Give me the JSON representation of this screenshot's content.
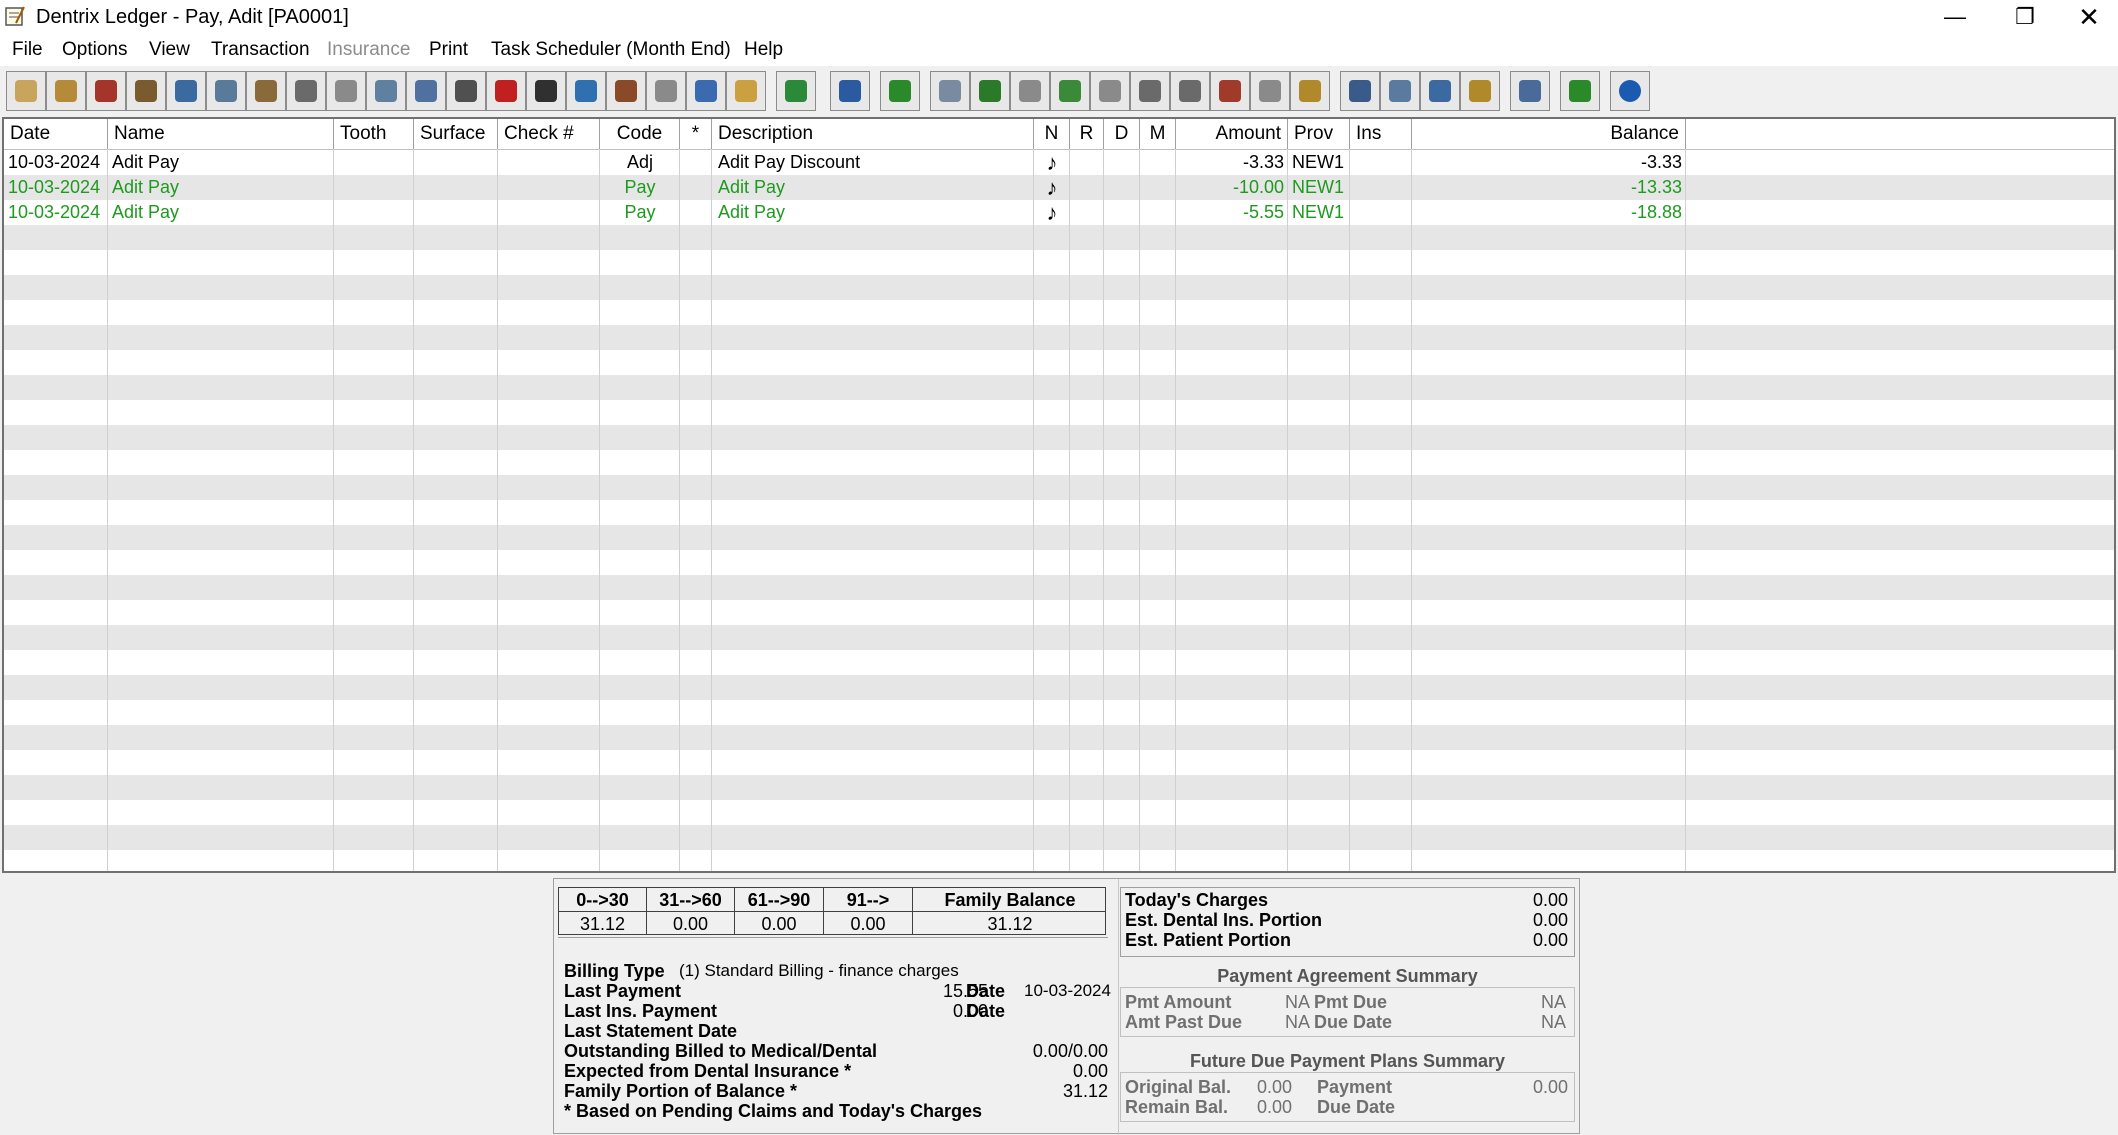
{
  "window": {
    "title": "Dentrix Ledger - Pay, Adit [PA0001]"
  },
  "menu": [
    {
      "label": "File",
      "disabled": false
    },
    {
      "label": "Options",
      "disabled": false
    },
    {
      "label": "View",
      "disabled": false
    },
    {
      "label": "Transaction",
      "disabled": false
    },
    {
      "label": "Insurance",
      "disabled": true
    },
    {
      "label": "Print",
      "disabled": false
    },
    {
      "label": "Task Scheduler (Month End)",
      "disabled": false
    },
    {
      "label": "Help",
      "disabled": false
    }
  ],
  "toolbar_icons": [
    "tooth-icon",
    "folder-icon",
    "book-icon",
    "chair-icon",
    "patient-card-icon",
    "map-icon",
    "pen-icon",
    "eraser-icon",
    "note-icon",
    "clock-icon",
    "at-icon",
    "list-icon",
    "medical-cross-icon",
    "rx-icon",
    "credit-card-icon",
    "wallet-icon",
    "lab-icon",
    "box-icon",
    "eob-icon",
    "plant-icon",
    "person-icon",
    "refresh-icon",
    "handshake-icon",
    "dollar-icon",
    "g-icon",
    "transfer-icon",
    "tooth-plan-icon",
    "ins-claim-icon",
    "ins-batch-icon",
    "tx-icon",
    "calculator-icon",
    "save-icon",
    "walk-icon",
    "mail-icon",
    "family-icon",
    "door-icon",
    "doctor-icon",
    "user-add-icon",
    "info-icon"
  ],
  "columns": [
    "Date",
    "Name",
    "Tooth",
    "Surface",
    "Check #",
    "Code",
    "*",
    "Description",
    "N",
    "R",
    "D",
    "M",
    "Amount",
    "Prov",
    "Ins",
    "Balance"
  ],
  "rows": [
    {
      "date": "10-03-2024",
      "name": "Adit  Pay",
      "code": "Adj",
      "description": "Adit Pay Discount",
      "note": "♪",
      "amount": "-3.33",
      "prov": "NEW1",
      "balance": "-3.33",
      "color": "#000000"
    },
    {
      "date": "10-03-2024",
      "name": "Adit  Pay",
      "code": "Pay",
      "description": "Adit Pay",
      "note": "♪",
      "amount": "-10.00",
      "prov": "NEW1",
      "balance": "-13.33",
      "color": "#1e9a1e"
    },
    {
      "date": "10-03-2024",
      "name": "Adit  Pay",
      "code": "Pay",
      "description": "Adit Pay",
      "note": "♪",
      "amount": "-5.55",
      "prov": "NEW1",
      "balance": "-18.88",
      "color": "#1e9a1e"
    }
  ],
  "aging": {
    "headers": [
      "0-->30",
      "31-->60",
      "61-->90",
      "91-->",
      "Family Balance"
    ],
    "values": [
      "31.12",
      "0.00",
      "0.00",
      "0.00",
      "31.12"
    ]
  },
  "billing": {
    "billing_type_label": "Billing Type",
    "billing_type_value": "(1) Standard Billing - finance charges",
    "last_payment_label": "Last Payment",
    "last_payment_value": "15.55",
    "date_label": "Date",
    "last_payment_date": "10-03-2024",
    "last_ins_payment_label": "Last Ins. Payment",
    "last_ins_payment_value": "0.00",
    "last_ins_date_label": "Date",
    "last_statement_label": "Last Statement Date",
    "outstanding_label": "Outstanding Billed to Medical/Dental",
    "outstanding_value": "0.00/0.00",
    "expected_label": "Expected from Dental Insurance *",
    "expected_value": "0.00",
    "family_portion_label": "Family Portion of Balance *",
    "family_portion_value": "31.12",
    "footnote": "* Based on Pending Claims and Today's Charges"
  },
  "today": {
    "charges_label": "Today's Charges",
    "charges_value": "0.00",
    "ins_label": "Est. Dental Ins. Portion",
    "ins_value": "0.00",
    "patient_label": "Est. Patient Portion",
    "patient_value": "0.00"
  },
  "payment_agreement": {
    "title": "Payment Agreement Summary",
    "pmt_amount_label": "Pmt Amount",
    "pmt_amount_value": "NA",
    "pmt_due_label": "Pmt Due",
    "pmt_due_value": "NA",
    "amt_past_due_label": "Amt Past Due",
    "amt_past_due_value": "NA",
    "due_date_label": "Due Date",
    "due_date_value": "NA"
  },
  "future_plans": {
    "title": "Future Due Payment Plans Summary",
    "original_bal_label": "Original Bal.",
    "original_bal_value": "0.00",
    "payment_label": "Payment",
    "payment_value": "0.00",
    "remain_bal_label": "Remain Bal.",
    "remain_bal_value": "0.00",
    "due_date_label": "Due Date"
  }
}
